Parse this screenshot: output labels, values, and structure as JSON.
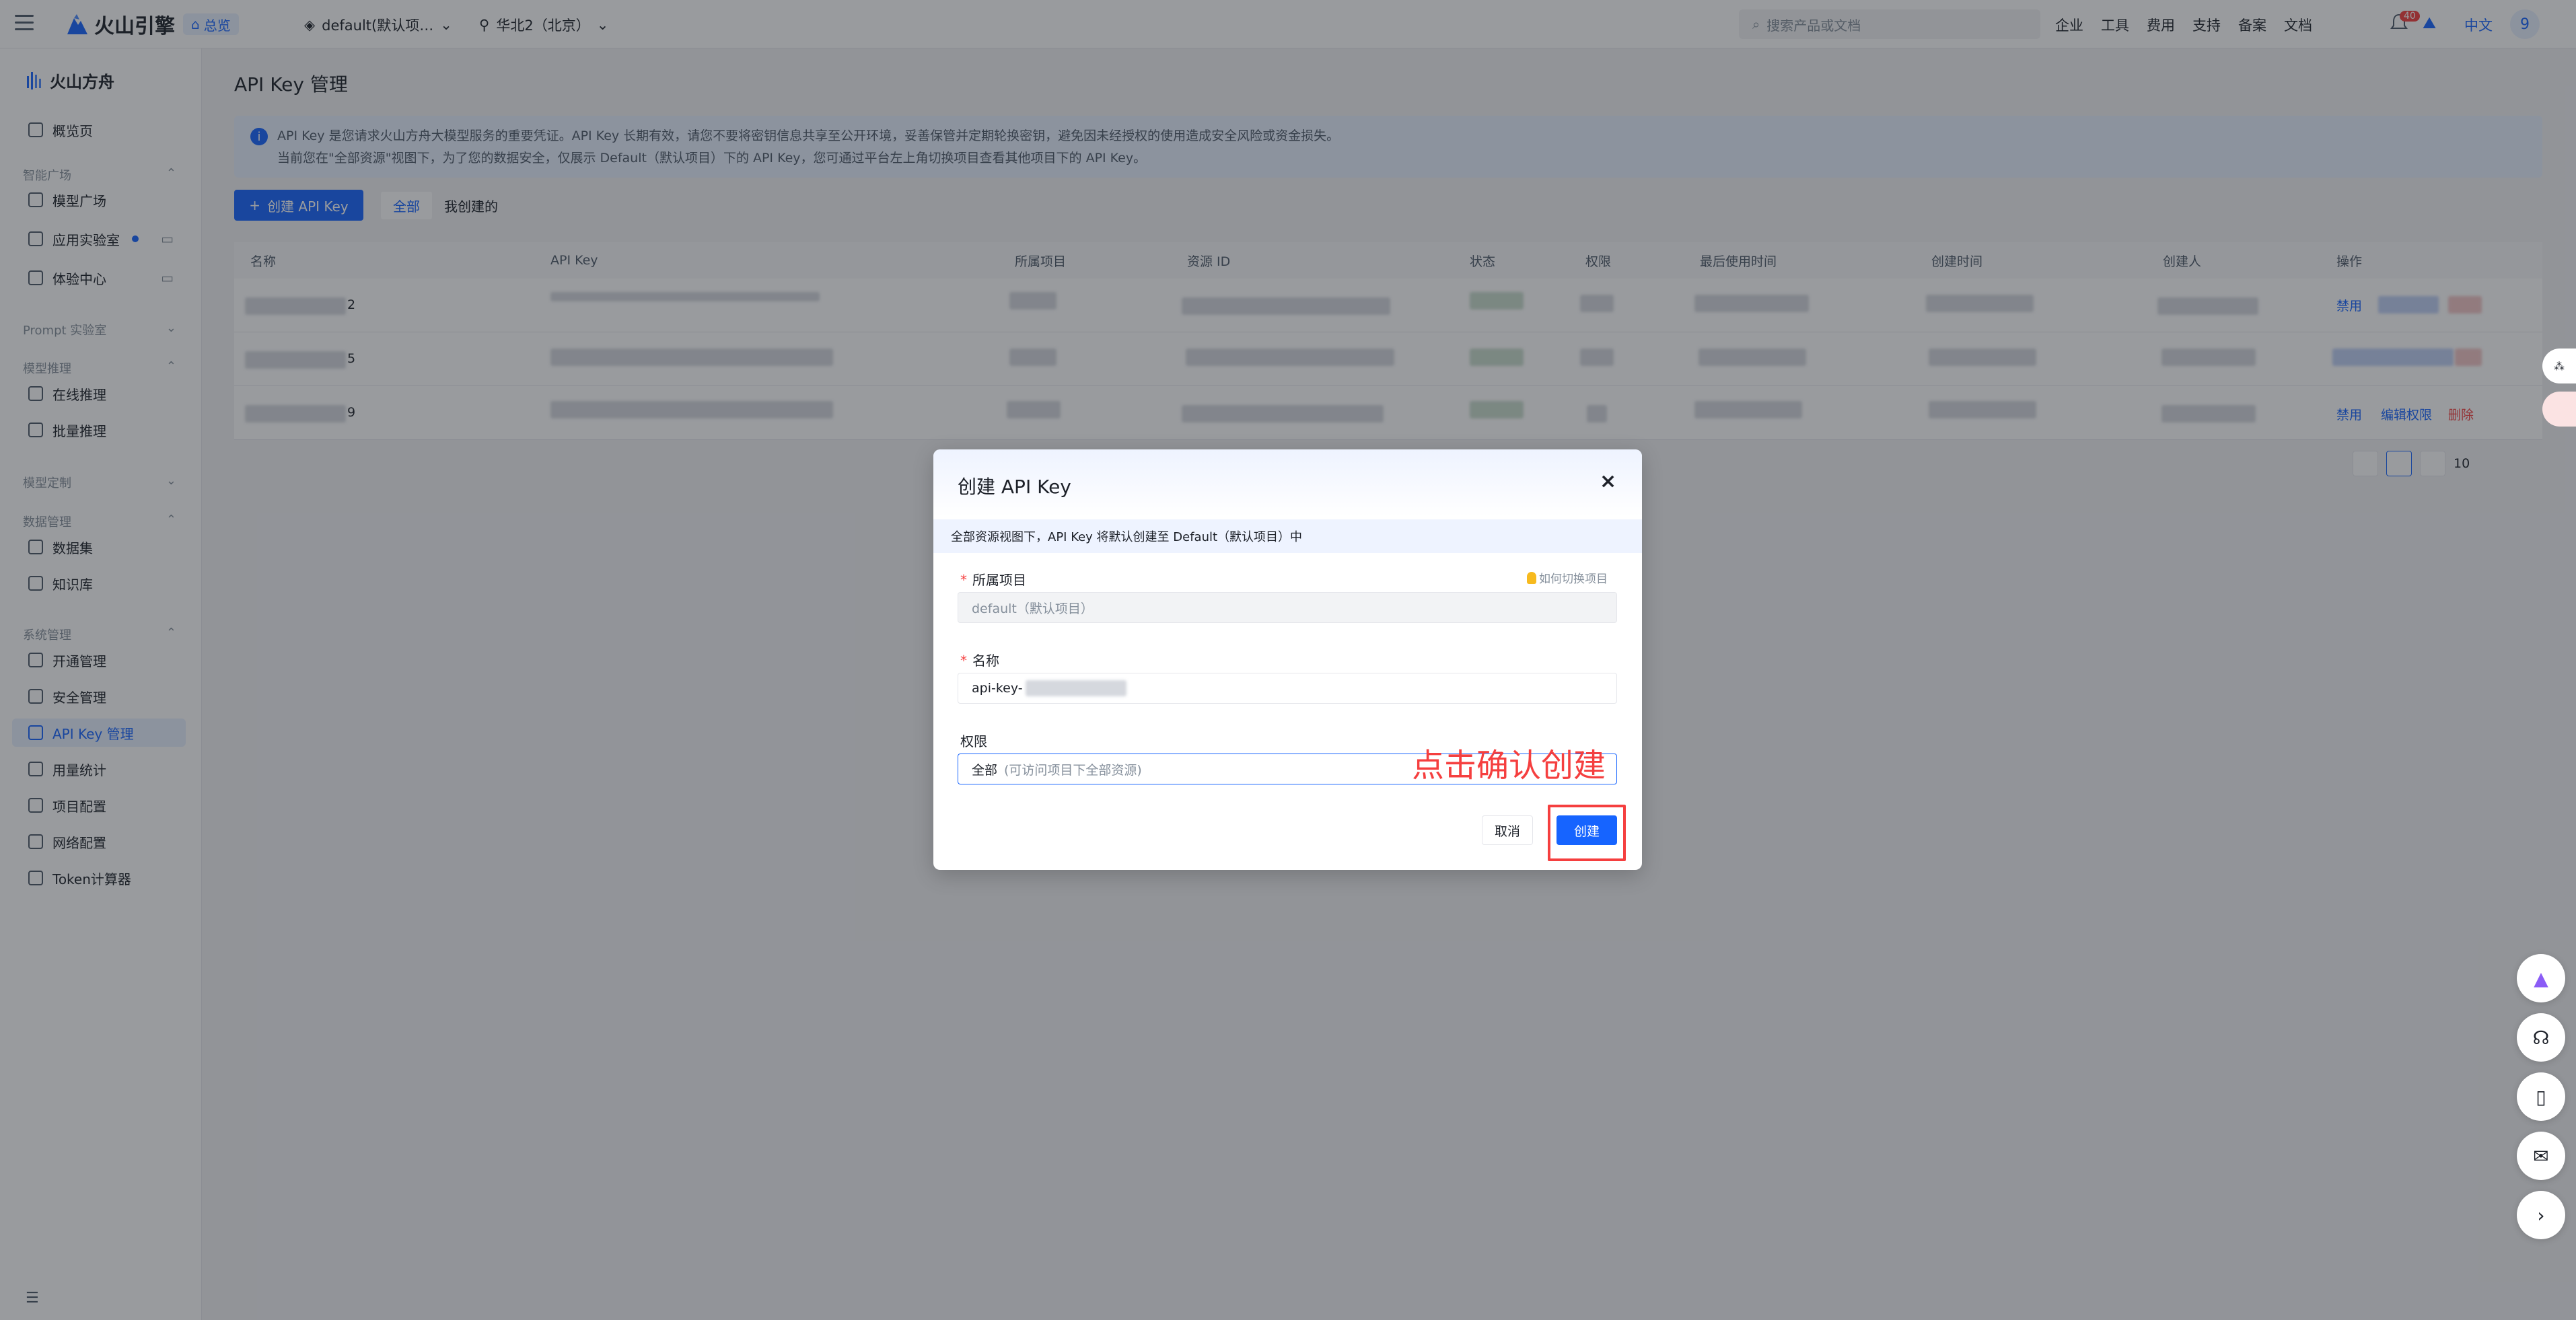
{
  "topbar": {
    "brand": "火山引擎",
    "home_badge": "总览",
    "project_select": "default(默认项…",
    "region_select": "华北2（北京）",
    "search_placeholder": "搜索产品或文档",
    "nav": [
      "企业",
      "工具",
      "费用",
      "支持",
      "备案",
      "文档"
    ],
    "notification_count": "40",
    "language": "中文",
    "avatar_initial": "9"
  },
  "sidebar": {
    "brand": "火山方舟",
    "overview": "概览页",
    "groups": {
      "smart_plaza": "智能广场",
      "prompt_lab": "Prompt 实验室",
      "model_infer": "模型推理",
      "model_custom": "模型定制",
      "data_mgmt": "数据管理",
      "system_mgmt": "系统管理"
    },
    "items": {
      "model_plaza": "模型广场",
      "app_lab": "应用实验室",
      "experience": "体验中心",
      "online_infer": "在线推理",
      "batch_infer": "批量推理",
      "dataset": "数据集",
      "knowledge": "知识库",
      "activation": "开通管理",
      "security": "安全管理",
      "api_key": "API Key 管理",
      "usage": "用量统计",
      "project_config": "项目配置",
      "network_config": "网络配置",
      "token_calc": "Token计算器"
    }
  },
  "main": {
    "title": "API Key 管理",
    "alert_line1": "API Key 是您请求火山方舟大模型服务的重要凭证。API Key 长期有效，请您不要将密钥信息共享至公开环境，妥善保管并定期轮换密钥，避免因未经授权的使用造成安全风险或资金损失。",
    "alert_line2": "当前您在\"全部资源\"视图下，为了您的数据安全，仅展示 Default（默认项目）下的 API Key，您可通过平台左上角切换项目查看其他项目下的 API Key。",
    "create_button": "创建 API Key",
    "filter_all": "全部",
    "filter_mine": "我创建的",
    "columns": [
      "名称",
      "API Key",
      "所属项目",
      "资源 ID",
      "状态",
      "权限",
      "最后使用时间",
      "创建时间",
      "创建人",
      "操作"
    ],
    "row_suffixes": [
      "2",
      "5",
      "9"
    ],
    "row_actions": [
      "禁用",
      "禁用",
      "编辑权限",
      "删除"
    ],
    "page_size": "10"
  },
  "modal": {
    "title": "创建 API Key",
    "notice": "全部资源视图下，API Key 将默认创建至 Default（默认项目）中",
    "project_label": "所属项目",
    "project_help": "如何切换项目",
    "project_value": "default（默认项目）",
    "name_label": "名称",
    "name_value": "api-key-",
    "permission_label": "权限",
    "permission_value": "全部",
    "permission_hint": "(可访问项目下全部资源)",
    "cancel_button": "取消",
    "create_button": "创建",
    "annotation": "点击确认创建"
  }
}
